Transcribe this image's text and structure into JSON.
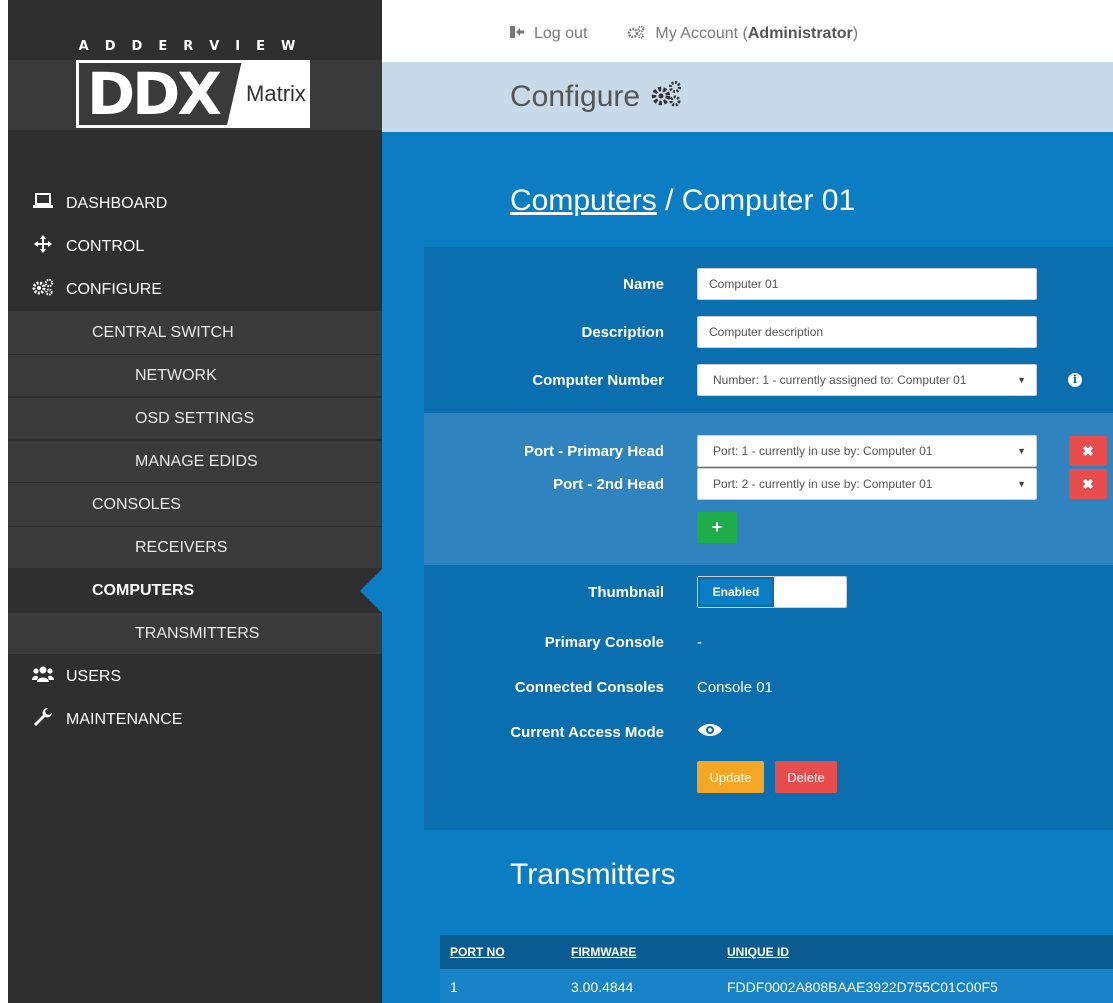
{
  "logo": {
    "brand": "ADDERVIEW",
    "product": "DDX",
    "product_suffix": "Matrix"
  },
  "topbar": {
    "logout_label": "Log out",
    "account_label": "My Account",
    "account_role": "Administrator"
  },
  "header": {
    "title": "Configure"
  },
  "sidebar": {
    "items": [
      {
        "label": "DASHBOARD"
      },
      {
        "label": "CONTROL"
      },
      {
        "label": "CONFIGURE"
      },
      {
        "label": "CENTRAL SWITCH"
      },
      {
        "label": "NETWORK"
      },
      {
        "label": "OSD SETTINGS"
      },
      {
        "label": "MANAGE EDIDS"
      },
      {
        "label": "CONSOLES"
      },
      {
        "label": "RECEIVERS"
      },
      {
        "label": "COMPUTERS"
      },
      {
        "label": "TRANSMITTERS"
      },
      {
        "label": "USERS"
      },
      {
        "label": "MAINTENANCE"
      }
    ]
  },
  "breadcrumb": {
    "parent": "Computers",
    "separator": "/",
    "current": "Computer 01"
  },
  "form": {
    "name_label": "Name",
    "name_value": "Computer 01",
    "description_label": "Description",
    "description_value": "Computer description",
    "computer_number_label": "Computer Number",
    "computer_number_value": "Number: 1 - currently assigned to: Computer 01",
    "port_primary_label": "Port - Primary Head",
    "port_primary_value": "Port: 1 - currently in use by: Computer 01",
    "port_second_label": "Port - 2nd Head",
    "port_second_value": "Port: 2 - currently in use by: Computer 01",
    "add_symbol": "+",
    "remove_symbol": "✖",
    "thumbnail_label": "Thumbnail",
    "thumbnail_state": "Enabled",
    "primary_console_label": "Primary Console",
    "primary_console_value": "-",
    "connected_consoles_label": "Connected Consoles",
    "connected_consoles_value": "Console 01",
    "access_mode_label": "Current Access Mode",
    "update_label": "Update",
    "delete_label": "Delete"
  },
  "transmitters": {
    "title": "Transmitters",
    "columns": [
      "PORT NO",
      "FIRMWARE",
      "UNIQUE ID"
    ],
    "rows": [
      [
        "1",
        "3.00.4844",
        "FDDF0002A808BAAE3922D755C01C00F5"
      ]
    ]
  },
  "colors": {
    "sidebar": "#2f2f2f",
    "main": "#0b7dc2",
    "panel": "#0a6eaf",
    "danger": "#e94c4c",
    "success": "#1fad4a",
    "warning": "#f5a623"
  }
}
